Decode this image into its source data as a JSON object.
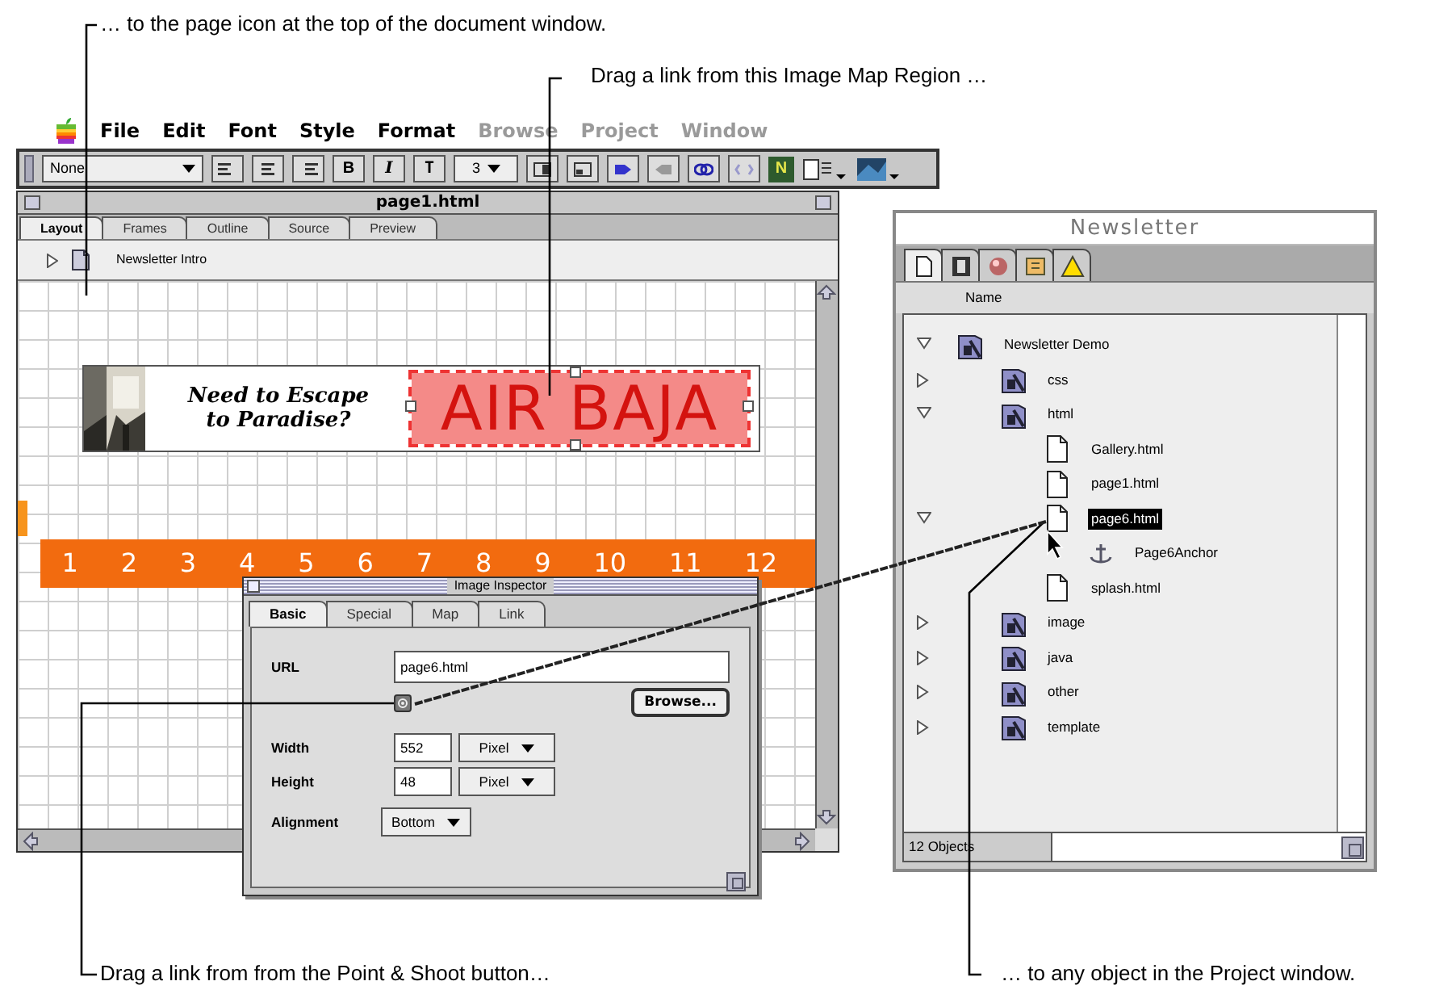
{
  "callouts": [
    {
      "kind": "top",
      "text": "… to the page icon at the top of the document window."
    },
    {
      "kind": "map",
      "text": "Drag a link from this Image Map Region …"
    },
    {
      "kind": "bottom_left",
      "text": "Drag a link from from the Point & Shoot button…"
    },
    {
      "kind": "bottom_right",
      "text": "… to any object in the Project window."
    }
  ],
  "menu_bar": {
    "items": [
      {
        "label": "File",
        "disabled": false
      },
      {
        "label": "Edit",
        "disabled": false
      },
      {
        "label": "Font",
        "disabled": false
      },
      {
        "label": "Style",
        "disabled": false
      },
      {
        "label": "Format",
        "disabled": false
      },
      {
        "label": "Browse",
        "disabled": true
      },
      {
        "label": "Project",
        "disabled": true
      },
      {
        "label": "Window",
        "disabled": true
      }
    ]
  },
  "toolbar": {
    "format_select": "None",
    "bold": "B",
    "italic": "I",
    "teletype": "T",
    "size_select": "3",
    "color_swatch": "N"
  },
  "document_window": {
    "title": "page1.html",
    "tabs": [
      {
        "label": "Layout",
        "selected": true
      },
      {
        "label": "Frames",
        "selected": false
      },
      {
        "label": "Outline",
        "selected": false
      },
      {
        "label": "Source",
        "selected": false
      },
      {
        "label": "Preview",
        "selected": false
      }
    ],
    "page_title": "Newsletter Intro",
    "banner": {
      "headline_1": "Need to Escape",
      "headline_2": "to Paradise?",
      "logo": "AIR BAJA",
      "map_region_selected": true
    },
    "nav_numbers": [
      "1",
      "2",
      "3",
      "4",
      "5",
      "6",
      "7",
      "8",
      "9",
      "10",
      "11",
      "12"
    ]
  },
  "inspector": {
    "title": "Image Inspector",
    "tabs": [
      {
        "label": "Basic",
        "selected": true
      },
      {
        "label": "Special",
        "selected": false
      },
      {
        "label": "Map",
        "selected": false
      },
      {
        "label": "Link",
        "selected": false
      }
    ],
    "url_label": "URL",
    "url": "page6.html",
    "browse_button": "Browse...",
    "fields": [
      {
        "label": "Width",
        "value": "552",
        "unit": "Pixel"
      },
      {
        "label": "Height",
        "value": "48",
        "unit": "Pixel"
      }
    ],
    "alignment": {
      "label": "Alignment",
      "value": "Bottom"
    }
  },
  "project_window": {
    "title": "Newsletter",
    "tabs": [
      {
        "kind": "page",
        "selected": true
      },
      {
        "kind": "film",
        "selected": false
      },
      {
        "kind": "sphere",
        "selected": false
      },
      {
        "kind": "note",
        "selected": false
      },
      {
        "kind": "warning",
        "selected": false
      }
    ],
    "column": "Name",
    "tree": [
      {
        "kind": "folder",
        "name": "Newsletter Demo",
        "expanded": true,
        "selected": false,
        "children": [
          {
            "kind": "folder",
            "name": "css",
            "expanded": false,
            "selected": false
          },
          {
            "kind": "folder",
            "name": "html",
            "expanded": true,
            "selected": false,
            "children": [
              {
                "kind": "file",
                "name": "Gallery.html",
                "selected": false
              },
              {
                "kind": "file",
                "name": "page1.html",
                "selected": false
              },
              {
                "kind": "file",
                "name": "page6.html",
                "expanded": true,
                "selected": true,
                "children": [
                  {
                    "kind": "anchor",
                    "name": "Page6Anchor",
                    "selected": false
                  }
                ]
              },
              {
                "kind": "file",
                "name": "splash.html",
                "selected": false
              }
            ]
          },
          {
            "kind": "folder",
            "name": "image",
            "expanded": false,
            "selected": false
          },
          {
            "kind": "folder",
            "name": "java",
            "expanded": false,
            "selected": false
          },
          {
            "kind": "folder",
            "name": "other",
            "expanded": false,
            "selected": false
          },
          {
            "kind": "folder",
            "name": "template",
            "expanded": false,
            "selected": false
          }
        ]
      }
    ],
    "status": "12 Objects"
  }
}
